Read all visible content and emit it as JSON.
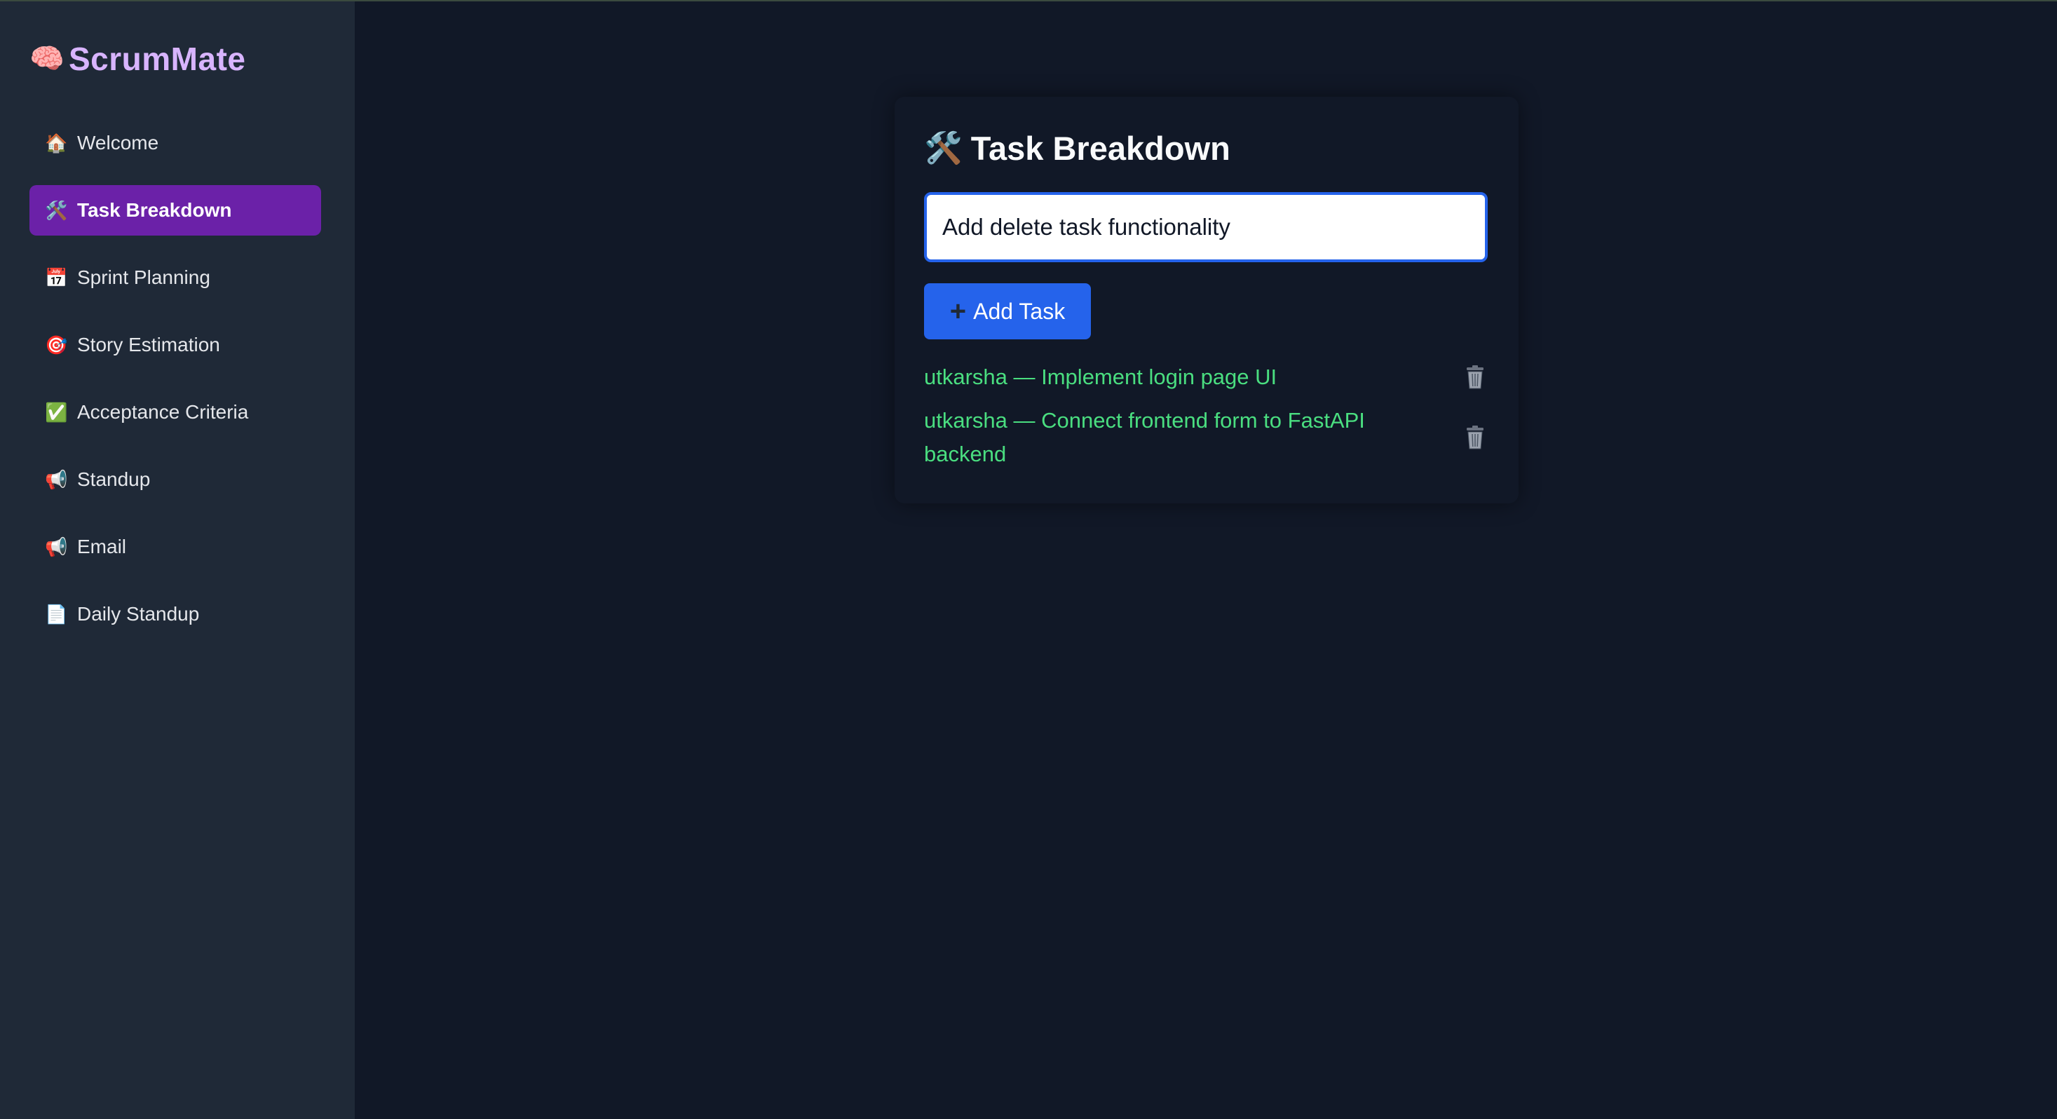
{
  "brand": {
    "icon": "🧠",
    "name": "ScrumMate"
  },
  "sidebar": {
    "items": [
      {
        "icon": "🏠",
        "label": "Welcome",
        "active": false
      },
      {
        "icon": "🛠️",
        "label": "Task Breakdown",
        "active": true
      },
      {
        "icon": "📅",
        "label": "Sprint Planning",
        "active": false
      },
      {
        "icon": "🎯",
        "label": "Story Estimation",
        "active": false
      },
      {
        "icon": "✅",
        "label": "Acceptance Criteria",
        "active": false
      },
      {
        "icon": "📢",
        "label": "Standup",
        "active": false
      },
      {
        "icon": "📢",
        "label": "Email",
        "active": false
      },
      {
        "icon": "📄",
        "label": "Daily Standup",
        "active": false
      }
    ]
  },
  "main": {
    "title_icon": "🛠️",
    "title": "Task Breakdown",
    "input_value": "Add delete task functionality",
    "add_button_icon": "+",
    "add_button_label": "Add Task",
    "tasks": [
      {
        "text": "utkarsha — Implement login page UI",
        "delete_icon": "trash-icon"
      },
      {
        "text": "utkarsha — Connect frontend form to FastAPI backend",
        "delete_icon": "trash-icon"
      }
    ]
  },
  "colors": {
    "app_background": "#111827",
    "sidebar_background": "#1f2937",
    "brand": "#d8b4fe",
    "active_nav": "#6b21a8",
    "primary_button": "#2563eb",
    "task_text": "#4ade80"
  }
}
